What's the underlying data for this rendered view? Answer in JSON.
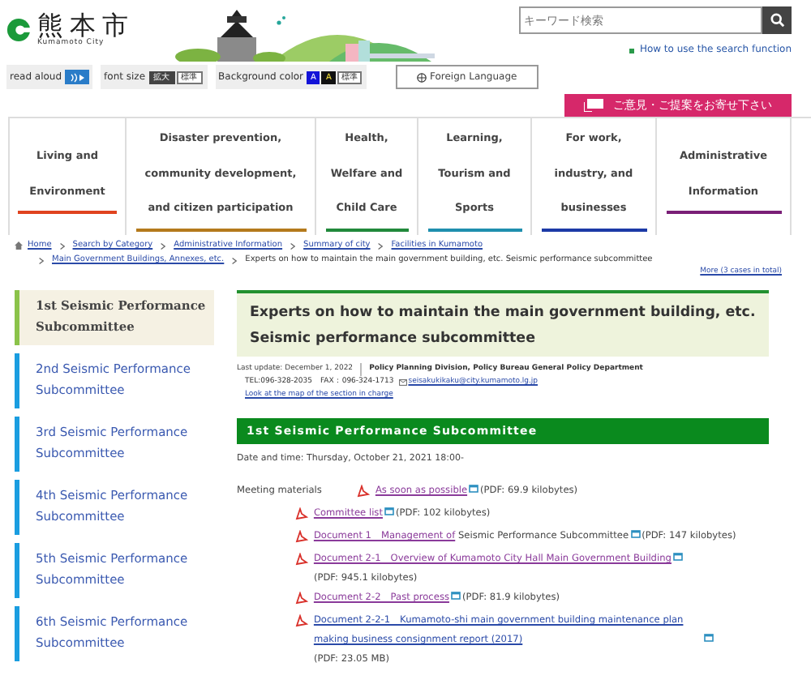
{
  "logo": {
    "name": "熊本市",
    "romaji": "Kumamoto City"
  },
  "search": {
    "placeholder": "キーワード検索",
    "help_link": "How to use the search function"
  },
  "toolbar": {
    "read_aloud": "read aloud",
    "font_size": "font size",
    "font_buttons": [
      "拡大",
      "標準"
    ],
    "background": "Background color",
    "background_buttons": [
      {
        "label": "A",
        "kind": "blue"
      },
      {
        "label": "A",
        "kind": "black"
      },
      {
        "label": "標準",
        "kind": "plain"
      }
    ],
    "language": "Foreign Language"
  },
  "feedback_button": "ご意見・ご提案をお寄せ下さい",
  "nav": [
    {
      "lines": [
        "Living and",
        "Environment"
      ],
      "color": "#e0431f"
    },
    {
      "lines": [
        "Disaster prevention,",
        "community development,",
        "and citizen participation"
      ],
      "color": "#b47a1c"
    },
    {
      "lines": [
        "Health,",
        "Welfare and",
        "Child Care"
      ],
      "color": "#21893b"
    },
    {
      "lines": [
        "Learning,",
        "Tourism and",
        "Sports"
      ],
      "color": "#1f8fae"
    },
    {
      "lines": [
        "For work,",
        "industry, and",
        "businesses"
      ],
      "color": "#1c3aa6"
    },
    {
      "lines": [
        "Administrative",
        "Information"
      ],
      "color": "#7a1f77"
    }
  ],
  "breadcrumb": {
    "links": [
      "Home",
      "Search by Category",
      "Administrative Information",
      "Summary of city",
      "Facilities in Kumamoto",
      "Main Government Buildings, Annexes, etc."
    ],
    "current": "Experts on how to maintain the main government building, etc. Seismic performance subcommittee",
    "more": "More (3 cases in total)"
  },
  "sidebar": [
    {
      "label": "1st Seismic Performance Subcommittee",
      "selected": true
    },
    {
      "label": "2nd Seismic Performance Subcommittee",
      "selected": false
    },
    {
      "label": "3rd Seismic Performance Subcommittee",
      "selected": false
    },
    {
      "label": "4th Seismic Performance Subcommittee",
      "selected": false
    },
    {
      "label": "5th Seismic Performance Subcommittee",
      "selected": false
    },
    {
      "label": "6th Seismic Performance Subcommittee",
      "selected": false
    }
  ],
  "page_title": "Experts on how to maintain the main government building, etc. Seismic performance subcommittee",
  "info": {
    "last_update": "Last update: December 1, 2022",
    "department": "Policy Planning Division, Policy Bureau General Policy Department",
    "phone": "TEL:096-328-2035　FAX：096-324-1713",
    "email": "seisakukikaku@city.kumamoto.lg.jp",
    "map_link": "Look at the map of the section in charge"
  },
  "section_title": "1st Seismic Performance Subcommittee",
  "date": "Date and time: Thursday, October 21, 2021 18:00-",
  "materials_label": "Meeting materials",
  "materials": [
    {
      "link": "As soon as possible",
      "size": "(PDF: 69.9 kilobytes)",
      "visited": true
    },
    {
      "link": "Committee list",
      "size": "(PDF: 102 kilobytes)",
      "visited": true
    },
    {
      "link": "Document 1　Management of",
      "text": "Seismic Performance Subcommittee",
      "size": "(PDF: 147 kilobytes)",
      "visited": true
    },
    {
      "link": "Document 2-1　Overview of Kumamoto City Hall Main Government Building",
      "size": "(PDF: 945.1 kilobytes)",
      "visited": true
    },
    {
      "link": "Document 2-2　Past process",
      "size": "(PDF: 81.9 kilobytes)",
      "visited": true
    },
    {
      "link": "Document 2-2-1　Kumamoto-shi main government building maintenance plan making business consignment report (2017)",
      "size": "(PDF: 23.05 MB)",
      "visited": false
    }
  ]
}
